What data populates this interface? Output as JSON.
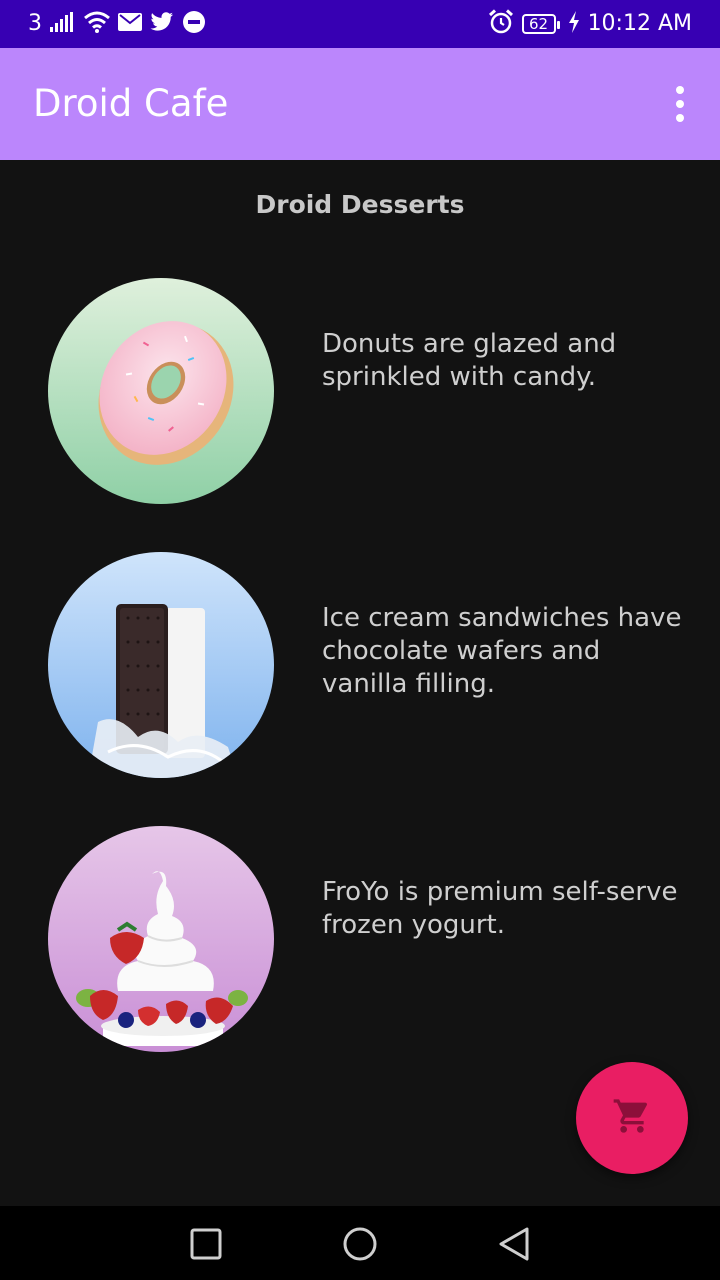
{
  "status_bar": {
    "network": "3",
    "battery": "62",
    "time": "10:12 AM",
    "icons": [
      "signal-icon",
      "wifi-icon",
      "mail-icon",
      "twitter-icon",
      "message-icon",
      "alarm-icon",
      "battery-icon",
      "charging-icon"
    ]
  },
  "app_bar": {
    "title": "Droid Cafe",
    "overflow_icon": "more-vert-icon"
  },
  "main": {
    "intro": "Droid Desserts",
    "items": [
      {
        "name": "donut",
        "description": "Donuts are glazed and sprinkled with candy."
      },
      {
        "name": "ice-cream-sandwich",
        "description": "Ice cream sandwiches have chocolate wafers and vanilla filling."
      },
      {
        "name": "froyo",
        "description": "FroYo is premium self-serve frozen yogurt."
      }
    ]
  },
  "fab": {
    "icon": "shopping-cart-icon",
    "color": "#e91e63"
  },
  "nav_bar": {
    "buttons": [
      "recents-button",
      "home-button",
      "back-button"
    ]
  },
  "colors": {
    "status_bar": "#3700b3",
    "app_bar": "#bb86fc",
    "background": "#121212"
  }
}
